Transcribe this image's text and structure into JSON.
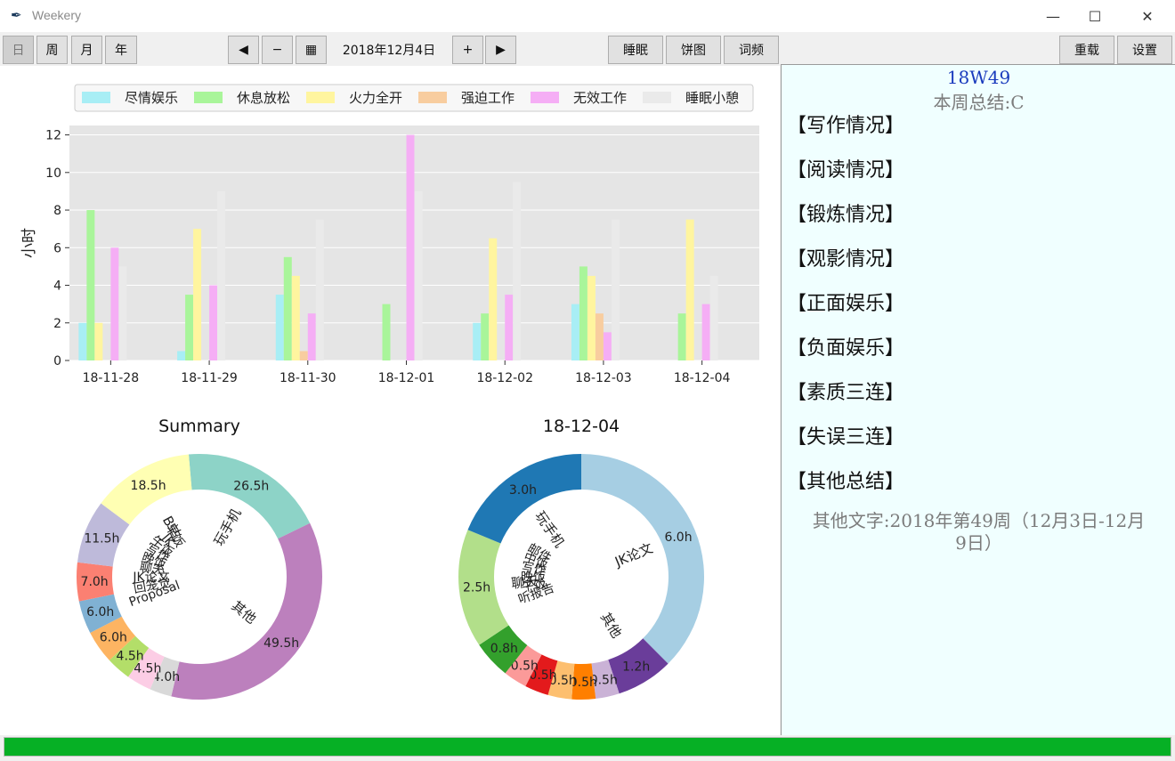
{
  "window": {
    "title": "Weekery"
  },
  "toolbar": {
    "view_buttons": [
      "日",
      "周",
      "月",
      "年"
    ],
    "prev": "◀",
    "minus": "−",
    "calendar": "▦",
    "date": "2018年12月4日",
    "plus": "+",
    "next": "▶",
    "sleep": "睡眠",
    "pie": "饼图",
    "words": "词频",
    "reload": "重载",
    "settings": "设置"
  },
  "colors": {
    "categories": [
      "#a8eef5",
      "#a9f59a",
      "#fff59f",
      "#f8cd9f",
      "#f5aef5",
      "#eaeaea"
    ],
    "accent_progress": "#06b025"
  },
  "chart_data": [
    {
      "type": "bar",
      "ylabel": "小时",
      "ylim": [
        0,
        12.5
      ],
      "yticks": [
        0,
        2,
        4,
        6,
        8,
        10,
        12
      ],
      "grid": true,
      "legend_placement": "top",
      "categories": [
        "18-11-28",
        "18-11-29",
        "18-11-30",
        "18-12-01",
        "18-12-02",
        "18-12-03",
        "18-12-04"
      ],
      "series": [
        {
          "name": "尽情娱乐",
          "values": [
            2,
            0.5,
            3.5,
            0,
            2,
            3,
            0
          ]
        },
        {
          "name": "休息放松",
          "values": [
            8,
            3.5,
            5.5,
            3,
            2.5,
            5,
            2.5
          ]
        },
        {
          "name": "火力全开",
          "values": [
            2,
            7,
            4.5,
            0,
            6.5,
            4.5,
            7.5
          ]
        },
        {
          "name": "强迫工作",
          "values": [
            0,
            0,
            0.5,
            0,
            0,
            2.5,
            0
          ]
        },
        {
          "name": "无效工作",
          "values": [
            6,
            4,
            2.5,
            12,
            3.5,
            1.5,
            3
          ]
        },
        {
          "name": "睡眠小憩",
          "values": [
            5,
            9,
            7.5,
            9,
            9.5,
            7.5,
            4.5
          ]
        }
      ]
    },
    {
      "type": "pie",
      "title": "Summary",
      "slices": [
        {
          "label": "玩手机",
          "value": 26.5,
          "value_label": "26.5h",
          "color": "#8dd3c7"
        },
        {
          "label": "其他",
          "value": 49.5,
          "value_label": "49.5h",
          "color": "#bc80bd"
        },
        {
          "label": "",
          "value": 4.0,
          "value_label": "4.0h",
          "color": "#d9d9d9"
        },
        {
          "label": "",
          "value": 4.5,
          "value_label": "4.5h",
          "color": "#fccde5"
        },
        {
          "label": "",
          "value": 4.5,
          "value_label": "4.5h",
          "color": "#b3de69"
        },
        {
          "label": "",
          "value": 6.0,
          "value_label": "6.0h",
          "color": "#fdb462"
        },
        {
          "label": "",
          "value": 6.0,
          "value_label": "6.0h",
          "color": "#80b1d3"
        },
        {
          "label": "",
          "value": 7.0,
          "value_label": "7.0h",
          "color": "#fb8072"
        },
        {
          "label": "",
          "value": 11.5,
          "value_label": "11.5h",
          "color": "#bebada"
        },
        {
          "label": "B站",
          "value": 18.5,
          "value_label": "18.5h",
          "color": "#ffffb3"
        }
      ],
      "inner_labels": [
        "B站",
        "Proposal",
        "回笼觉",
        "JK论文",
        "聊天",
        "晚饭",
        "写作",
        "午饭",
        "JK",
        "早饭"
      ]
    },
    {
      "type": "pie",
      "title": "18-12-04",
      "slices": [
        {
          "label": "JK论文",
          "value": 6.0,
          "value_label": "6.0h",
          "color": "#a6cee3"
        },
        {
          "label": "其他",
          "value": 1.2,
          "value_label": "1.2h",
          "color": "#6a3d9a"
        },
        {
          "label": "",
          "value": 0.5,
          "value_label": "0.5h",
          "color": "#cab2d6"
        },
        {
          "label": "",
          "value": 0.5,
          "value_label": "0.5h",
          "color": "#ff7f00"
        },
        {
          "label": "",
          "value": 0.5,
          "value_label": "0.5h",
          "color": "#fdbf6f"
        },
        {
          "label": "",
          "value": 0.5,
          "value_label": "0.5h",
          "color": "#e31a1c"
        },
        {
          "label": "",
          "value": 0.5,
          "value_label": "0.5h",
          "color": "#fb9a99"
        },
        {
          "label": "",
          "value": 0.8,
          "value_label": "0.8h",
          "color": "#33a02c"
        },
        {
          "label": "聊天",
          "value": 2.5,
          "value_label": "2.5h",
          "color": "#b2df8a"
        },
        {
          "label": "玩手机",
          "value": 3.0,
          "value_label": "3.0h",
          "color": "#1f78b4"
        }
      ],
      "inner_labels": [
        "听报告",
        "午饭",
        "晚饭",
        "写作",
        "中饭",
        "邮件"
      ]
    }
  ],
  "panel": {
    "week_id": "18W49",
    "grade": "本周总结:C",
    "sections": [
      "【写作情况】",
      "【阅读情况】",
      "【锻炼情况】",
      "【观影情况】",
      "【正面娱乐】",
      "【负面娱乐】",
      "【素质三连】",
      "【失误三连】",
      "【其他总结】"
    ],
    "other_text_line1": "其他文字:2018年第49周（12月3日-12月",
    "other_text_line2": "9日）"
  },
  "progress": {
    "value": 1.0
  }
}
